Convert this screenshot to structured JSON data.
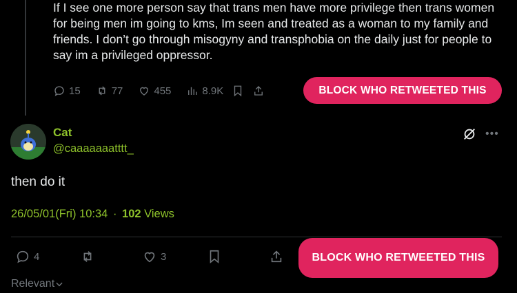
{
  "quoted_tweet": {
    "text": "If I see one more person say that trans men have more privilege then trans women for being men im going to kms, Im seen and treated as a woman to my family and friends. I don’t go through misogyny and transphobia on the daily just for people to say im a privileged oppressor.",
    "replies": "15",
    "retweets": "77",
    "likes": "455",
    "views": "8.9K"
  },
  "block_button_label": "BLOCK WHO RETWEETED THIS",
  "reply": {
    "name": "Cat",
    "handle": "@caaaaaaatttt_",
    "text": "then do it",
    "timestamp": "26/05/01(Fri) 10:34",
    "separator": "·",
    "views_count": "102",
    "views_label": "Views",
    "replies": "4",
    "likes": "3"
  },
  "sort_label": "Relevant",
  "colors": {
    "accent_green": "#8fc32b",
    "block_pink": "#e0245e",
    "muted": "#71767b"
  }
}
